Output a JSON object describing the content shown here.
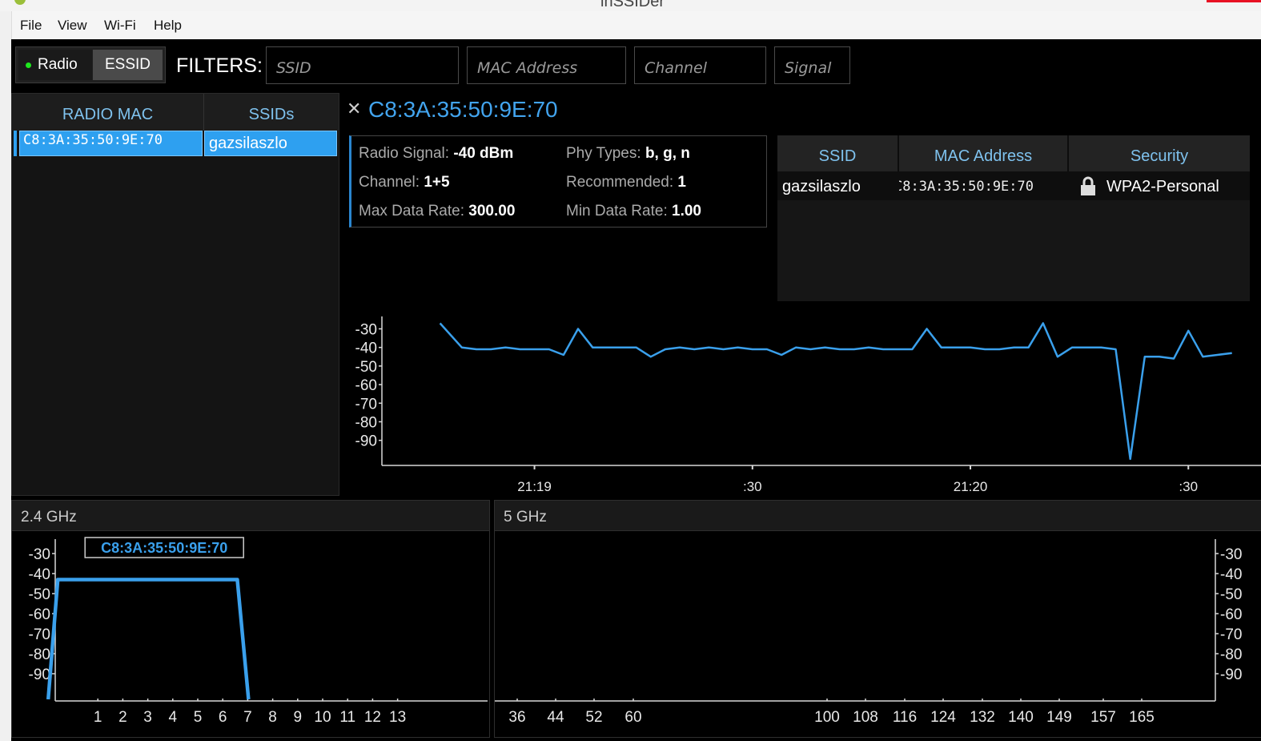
{
  "window": {
    "title": "inSSIDer"
  },
  "menu": {
    "items": [
      "File",
      "View",
      "Wi-Fi",
      "Help"
    ]
  },
  "toolbar": {
    "radio_label": "Radio",
    "essid_label": "ESSID",
    "filters_label": "FILTERS:",
    "filter_placeholders": {
      "ssid": "SSID",
      "mac": "MAC Address",
      "channel": "Channel",
      "signal": "Signal"
    }
  },
  "radio_table": {
    "headers": {
      "mac": "RADIO MAC",
      "ssids": "SSIDs"
    },
    "rows": [
      {
        "mac": "C8:3A:35:50:9E:70",
        "ssid": "gazsilaszlo"
      }
    ]
  },
  "detail": {
    "close_glyph": "✕",
    "title": "C8:3A:35:50:9E:70",
    "radio_signal_label": "Radio Signal:",
    "radio_signal": "-40 dBm",
    "phy_types_label": "Phy Types:",
    "phy_types": "b, g, n",
    "channel_label": "Channel:",
    "channel": "1+5",
    "recommended_label": "Recommended:",
    "recommended": "1",
    "max_rate_label": "Max Data Rate:",
    "max_rate": "300.00",
    "min_rate_label": "Min Data Rate:",
    "min_rate": "1.00"
  },
  "ssid_table": {
    "headers": {
      "ssid": "SSID",
      "mac": "MAC Address",
      "security": "Security"
    },
    "rows": [
      {
        "ssid": "gazsilaszlo",
        "mac": "C8:3A:35:50:9E:70",
        "security": "WPA2-Personal"
      }
    ]
  },
  "colors": {
    "accent": "#2ea0f0",
    "line": "#3aa0ec",
    "axis": "#d8d8d8"
  },
  "chart_data": [
    {
      "type": "line",
      "title": "",
      "y_ticks": [
        "-30",
        "-40",
        "-50",
        "-60",
        "-70",
        "-80",
        "-90"
      ],
      "ylim": [
        -100,
        -25
      ],
      "x_ticks": [
        "21:19",
        ":30",
        "21:20",
        ":30"
      ],
      "x_tick_seconds": [
        20,
        50,
        80,
        110
      ],
      "x_range_seconds": [
        -1,
        120
      ],
      "series": [
        {
          "seconds": [
            7,
            10,
            12,
            14,
            16,
            18,
            20,
            22,
            24,
            26,
            28,
            30,
            32,
            34,
            36,
            38,
            40,
            42,
            44,
            46,
            48,
            50,
            52,
            54,
            56,
            58,
            60,
            62,
            64,
            66,
            68,
            70,
            72,
            74,
            76,
            78,
            80,
            82,
            84,
            86,
            88,
            90,
            92,
            94,
            96,
            98,
            100,
            102,
            104,
            106,
            108,
            110,
            112,
            114,
            116
          ],
          "values": [
            -27,
            -40,
            -41,
            -41,
            -40,
            -41,
            -41,
            -41,
            -44,
            -30,
            -40,
            -40,
            -40,
            -40,
            -45,
            -41,
            -40,
            -41,
            -40,
            -41,
            -40,
            -41,
            -41,
            -44,
            -40,
            -41,
            -40,
            -41,
            -41,
            -40,
            -41,
            -41,
            -41,
            -30,
            -40,
            -40,
            -40,
            -41,
            -41,
            -40,
            -40,
            -27,
            -45,
            -40,
            -40,
            -40,
            -41,
            -100,
            -45,
            -45,
            -46,
            -31,
            -45,
            -44,
            -43
          ]
        }
      ]
    },
    {
      "type": "area",
      "title": "2.4 GHz",
      "y_ticks": [
        "-30",
        "-40",
        "-50",
        "-60",
        "-70",
        "-80",
        "-90"
      ],
      "ylim": [
        -100,
        -25
      ],
      "categories": [
        "1",
        "2",
        "3",
        "4",
        "5",
        "6",
        "7",
        "8",
        "9",
        "10",
        "11",
        "12",
        "13"
      ],
      "series": [
        {
          "name": "C8:3A:35:50:9E:70",
          "channel_span": [
            1,
            7
          ],
          "center_channel": 3.5,
          "signal": -43
        }
      ]
    },
    {
      "type": "area",
      "title": "5 GHz",
      "y_ticks": [
        "-30",
        "-40",
        "-50",
        "-60",
        "-70",
        "-80",
        "-90"
      ],
      "ylim": [
        -100,
        -25
      ],
      "categories": [
        "36",
        "44",
        "52",
        "60",
        "100",
        "108",
        "116",
        "124",
        "132",
        "140",
        "149",
        "157",
        "165"
      ],
      "series": []
    }
  ]
}
